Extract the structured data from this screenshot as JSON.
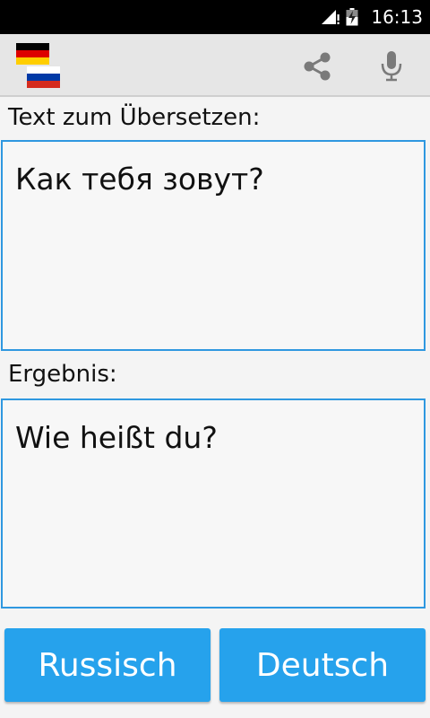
{
  "status_bar": {
    "time": "16:13",
    "icons": [
      "signal-icon",
      "battery-charging-icon"
    ]
  },
  "toolbar": {
    "flags": [
      "german-flag-icon",
      "russian-flag-icon"
    ],
    "actions": [
      "share-icon",
      "microphone-icon"
    ]
  },
  "source": {
    "label": "Text zum Übersetzen:",
    "text": "Как тебя зовут?"
  },
  "result": {
    "label": "Ergebnis:",
    "text": "Wie heißt du?"
  },
  "buttons": {
    "source_language": "Russisch",
    "target_language": "Deutsch"
  },
  "colors": {
    "accent": "#26a2ec",
    "border": "#2f98e0",
    "toolbar": "#e6e6e6"
  }
}
